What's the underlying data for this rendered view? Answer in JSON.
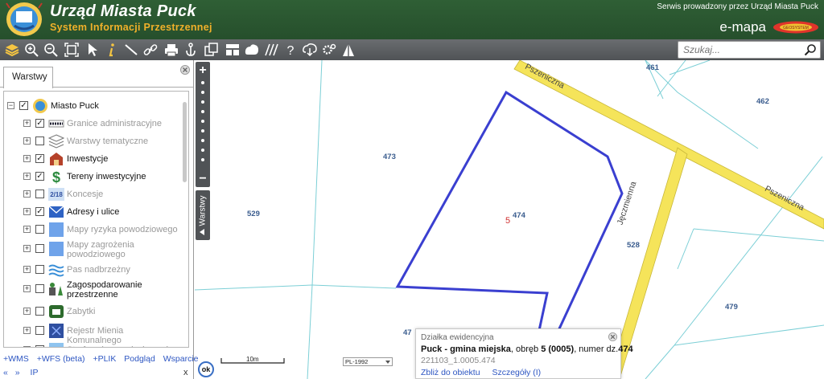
{
  "header": {
    "title": "Urząd Miasta Puck",
    "subtitle": "System Informacji Przestrzennej",
    "service_text": "Serwis prowadzony przez Urząd Miasta Puck",
    "brand": "e-mapa",
    "brand_logo_text": "GEOSYSTEM",
    "logo_icon": "coat-of-arms-icon"
  },
  "toolbar": {
    "tools": [
      "layers-icon",
      "zoom-in-icon",
      "zoom-out-icon",
      "zoom-extent-icon",
      "select-pointer-icon",
      "info-icon",
      "measure-distance-icon",
      "link-icon",
      "print-icon",
      "anchor-icon",
      "copy-icon",
      "layout-icon",
      "cloud-icon",
      "hatch-icon",
      "help-icon",
      "cloud-download-icon",
      "settings-icon",
      "triangle-icon"
    ],
    "search_placeholder": "Szukaj..."
  },
  "panel": {
    "tab_label": "Warstwy",
    "layers": [
      {
        "label": "Miasto Puck",
        "checked": true,
        "active": true,
        "icon": "city-crest-icon"
      },
      {
        "label": "Granice administracyjne",
        "checked": true,
        "active": false,
        "icon": "boundary-icon"
      },
      {
        "label": "Warstwy tematyczne",
        "checked": false,
        "active": false,
        "icon": "stack-icon"
      },
      {
        "label": "Inwestycje",
        "checked": true,
        "active": true,
        "icon": "investment-icon"
      },
      {
        "label": "Tereny inwestycyjne",
        "checked": true,
        "active": true,
        "icon": "dollar-icon"
      },
      {
        "label": "Koncesje",
        "checked": false,
        "active": false,
        "icon": "concession-icon",
        "icon_text": "2/18"
      },
      {
        "label": "Adresy i ulice",
        "checked": true,
        "active": true,
        "icon": "envelope-icon"
      },
      {
        "label": "Mapy ryzyka powodziowego",
        "checked": false,
        "active": false,
        "icon": "flood-risk-icon"
      },
      {
        "label": "Mapy zagrożenia powodziowego",
        "checked": false,
        "active": false,
        "icon": "flood-hazard-icon"
      },
      {
        "label": "Pas nadbrzeżny",
        "checked": false,
        "active": false,
        "icon": "waves-icon"
      },
      {
        "label": "Zagospodarowanie przestrzenne",
        "checked": false,
        "active": true,
        "icon": "spatial-plan-icon"
      },
      {
        "label": "Zabytki",
        "checked": false,
        "active": false,
        "icon": "monument-icon"
      },
      {
        "label": "Rejestr Mienia Komunalnego",
        "checked": false,
        "active": false,
        "icon": "registry-icon"
      },
      {
        "label": "Strefy ochrony ujęcia wody",
        "checked": false,
        "active": false,
        "icon": "water-zone-icon"
      }
    ],
    "links": [
      "+WMS",
      "+WFS (beta)",
      "+PLIK",
      "Podgląd",
      "Wsparcie"
    ],
    "links2": [
      "«",
      "»",
      "IP"
    ],
    "close_label": "x"
  },
  "map": {
    "side_tab": "Warstwy",
    "zoom_in": "+",
    "zoom_out": "−",
    "parcels": [
      "461",
      "462",
      "473",
      "474",
      "529",
      "528",
      "479",
      "47"
    ],
    "parcel_sublabel": "5",
    "streets": [
      "Pszeniczna",
      "Pszeniczna",
      "Jęczmienna"
    ],
    "scale_label": "10m",
    "crs": "PL-1992",
    "ok_label": "ok"
  },
  "popup": {
    "title": "Działka ewidencyjna",
    "place": "Puck - gmina miejska",
    "obreb_prefix": ", obręb ",
    "obreb": "5 (0005)",
    "numer_prefix": ", numer dz.",
    "numer": "474",
    "code": "221103_1.0005.474",
    "link_zoom": "Zbliż do obiektu",
    "link_details": "Szczegóły (I)"
  },
  "colors": {
    "header_bg": "#2a5730",
    "subtitle": "#f0b02a",
    "toolbar_bg": "#5c5f62",
    "street_fill": "#f5e45a",
    "parcel_line": "#7ccfd6",
    "selection": "#3a3fd0",
    "parcel_label": "#3a5c8e",
    "link": "#2d56c2"
  }
}
